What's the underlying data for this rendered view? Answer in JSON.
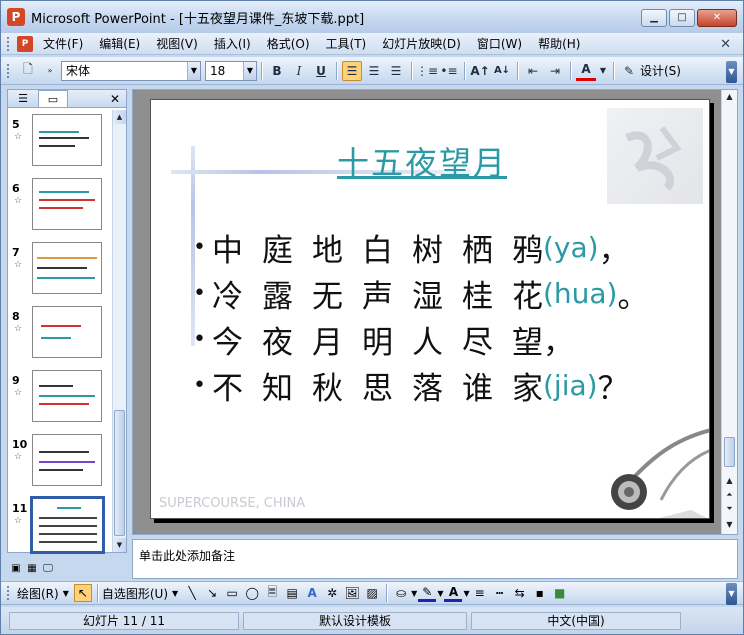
{
  "window": {
    "title": "Microsoft PowerPoint - [十五夜望月课件_东坡下载.ppt]",
    "app_icon": "P"
  },
  "menu": {
    "items": [
      "文件(F)",
      "编辑(E)",
      "视图(V)",
      "插入(I)",
      "格式(O)",
      "工具(T)",
      "幻灯片放映(D)",
      "窗口(W)",
      "帮助(H)"
    ]
  },
  "toolbar": {
    "font_name": "宋体",
    "font_size": "18",
    "bold": "B",
    "italic": "I",
    "underline": "U",
    "design_label": "设计(S)",
    "font_color_label": "A"
  },
  "thumbnails": [
    {
      "num": "5"
    },
    {
      "num": "6"
    },
    {
      "num": "7"
    },
    {
      "num": "8"
    },
    {
      "num": "9"
    },
    {
      "num": "10"
    },
    {
      "num": "11"
    }
  ],
  "slide": {
    "title": "十五夜望月",
    "watermark": "SUPERCOURSE, CHINA",
    "lines": [
      {
        "bullet": "•",
        "chars": "中庭地白树栖鸦",
        "pinyin": "(ya)",
        "punct": "，"
      },
      {
        "bullet": "•",
        "chars": "冷露无声湿桂花",
        "pinyin": "(hua)",
        "punct": "。"
      },
      {
        "bullet": "•",
        "chars": "今夜月明人尽望",
        "pinyin": "",
        "punct": "，"
      },
      {
        "bullet": "•",
        "chars": "不知秋思落谁家",
        "pinyin": "(jia)",
        "punct": "？"
      }
    ]
  },
  "notes": {
    "placeholder": "单击此处添加备注"
  },
  "drawbar": {
    "draw_label": "绘图(R)",
    "autoshapes_label": "自选图形(U)"
  },
  "status": {
    "slide_info": "幻灯片 11 / 11",
    "template": "默认设计模板",
    "language": "中文(中国)"
  },
  "colors": {
    "accent_teal": "#2a9aa4",
    "selection": "#ffd27a",
    "chrome": "#c6d8ee"
  }
}
